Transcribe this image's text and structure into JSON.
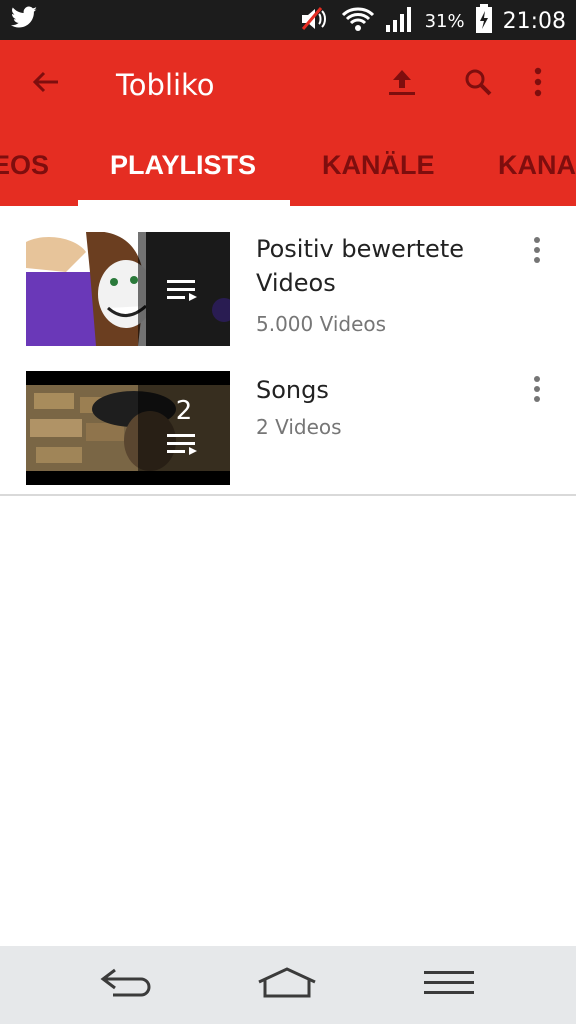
{
  "status_bar": {
    "battery_percent": "31%",
    "time": "21:08",
    "icons": [
      "twitter-icon",
      "mute-icon",
      "wifi-icon",
      "signal-icon",
      "battery-charging-icon"
    ]
  },
  "toolbar": {
    "title": "Tobliko",
    "icons": [
      "back-arrow-icon",
      "upload-icon",
      "search-icon",
      "more-vert-icon"
    ]
  },
  "tabs": [
    {
      "label": "EOS",
      "active": false
    },
    {
      "label": "PLAYLISTS",
      "active": true
    },
    {
      "label": "KANÄLE",
      "active": false
    },
    {
      "label": "KANA",
      "active": false
    }
  ],
  "playlists": [
    {
      "title": "Positiv bewertete Videos",
      "subtitle": "5.000 Videos",
      "count_badge": ""
    },
    {
      "title": "Songs",
      "subtitle": "2 Videos",
      "count_badge": "2"
    }
  ],
  "nav_bar": {
    "icons": [
      "back-nav-icon",
      "home-nav-icon",
      "menu-nav-icon"
    ]
  },
  "colors": {
    "brand_red": "#e52d22",
    "tab_inactive": "#7e0e0e",
    "status_bar": "#1c1c1c",
    "nav_bar": "#e6e8ea"
  }
}
